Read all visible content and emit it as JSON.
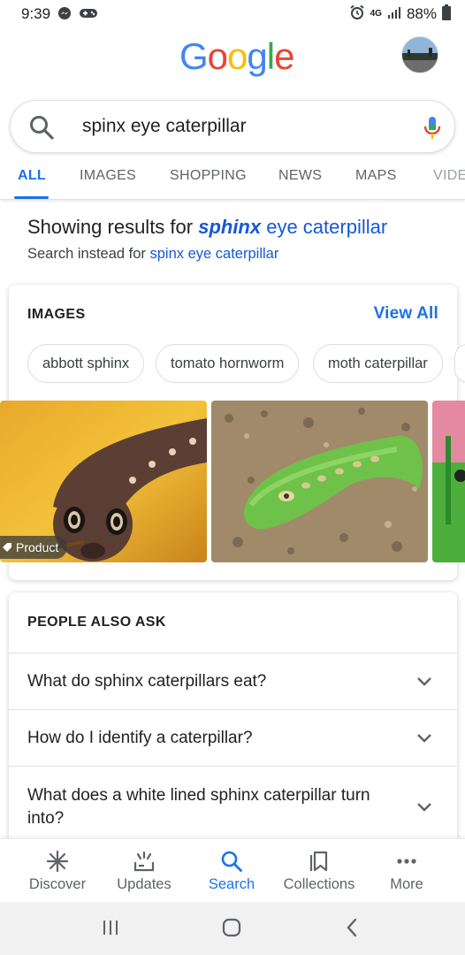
{
  "status_bar": {
    "time": "9:39",
    "network": "4G",
    "battery": "88%"
  },
  "header": {
    "logo": [
      "G",
      "o",
      "o",
      "g",
      "l",
      "e"
    ],
    "logo_colors": [
      "#4285F4",
      "#EA4335",
      "#FBBC05",
      "#4285F4",
      "#34A853",
      "#EA4335"
    ]
  },
  "search": {
    "query": "spinx eye caterpillar"
  },
  "tabs": [
    {
      "label": "ALL",
      "active": true
    },
    {
      "label": "IMAGES"
    },
    {
      "label": "SHOPPING"
    },
    {
      "label": "NEWS"
    },
    {
      "label": "MAPS"
    },
    {
      "label": "VIDE"
    }
  ],
  "correction": {
    "showing_prefix": "Showing results for ",
    "corrected_bold": "sphinx",
    "corrected_rest": " eye caterpillar",
    "instead_prefix": "Search instead for ",
    "instead_link": "spinx eye caterpillar"
  },
  "images_card": {
    "title": "IMAGES",
    "view_all": "View All",
    "chips": [
      "abbott sphinx",
      "tomato hornworm",
      "moth caterpillar"
    ],
    "badge": "Product"
  },
  "paa": {
    "title": "PEOPLE ALSO ASK",
    "questions": [
      "What do sphinx caterpillars eat?",
      "How do I identify a caterpillar?",
      "What does a white lined sphinx caterpillar turn into?"
    ]
  },
  "bottom_nav": [
    {
      "label": "Discover",
      "icon": "asterisk-icon"
    },
    {
      "label": "Updates",
      "icon": "updates-icon"
    },
    {
      "label": "Search",
      "icon": "search-icon",
      "active": true
    },
    {
      "label": "Collections",
      "icon": "collections-icon"
    },
    {
      "label": "More",
      "icon": "more-dots-icon"
    }
  ],
  "colors": {
    "accent": "#1a73e8",
    "link": "#1558d6"
  }
}
